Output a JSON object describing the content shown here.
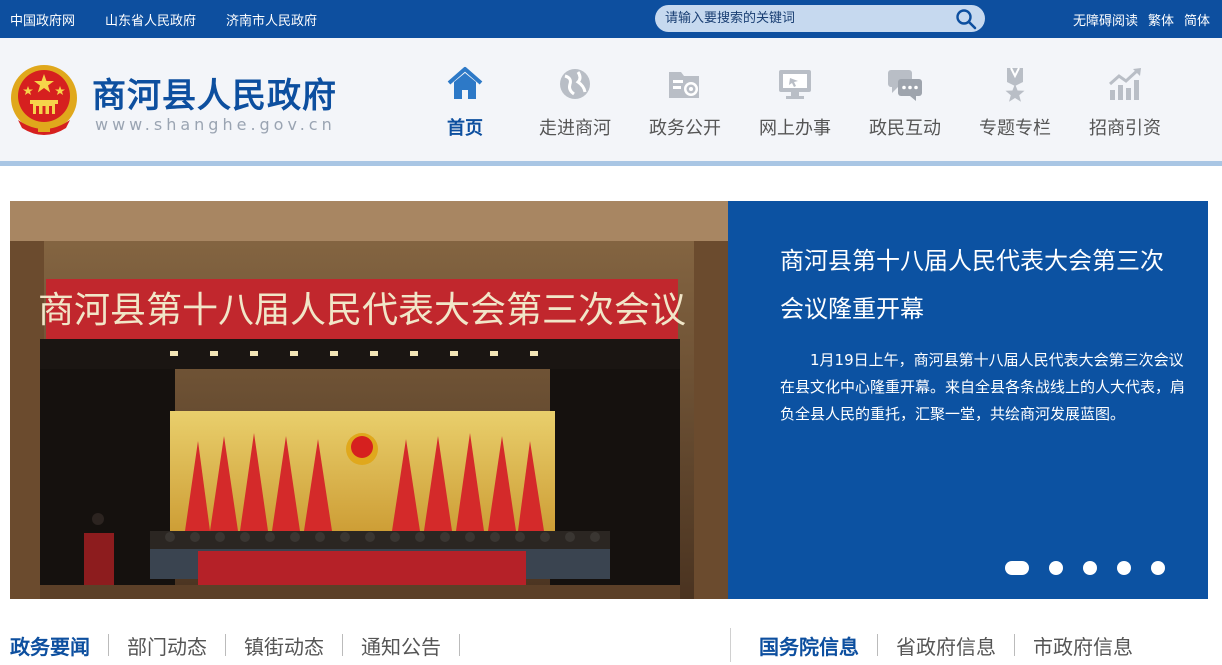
{
  "topbar": {
    "links": [
      "中国政府网",
      "山东省人民政府",
      "济南市人民政府"
    ],
    "search_placeholder": "请输入要搜索的关键词",
    "right_links": [
      "无障碍阅读",
      "繁体",
      "简体"
    ]
  },
  "header": {
    "site_name": "商河县人民政府",
    "site_url": "www.shanghe.gov.cn"
  },
  "nav": {
    "items": [
      {
        "label": "首页",
        "icon": "home-icon"
      },
      {
        "label": "走进商河",
        "icon": "globe-icon"
      },
      {
        "label": "政务公开",
        "icon": "folder-gear-icon"
      },
      {
        "label": "网上办事",
        "icon": "monitor-icon"
      },
      {
        "label": "政民互动",
        "icon": "chat-icon"
      },
      {
        "label": "专题专栏",
        "icon": "badge-icon"
      },
      {
        "label": "招商引资",
        "icon": "chart-icon"
      }
    ],
    "active_index": 0
  },
  "banner": {
    "stage_banner_text": "商河县第十八届人民代表大会第三次会议",
    "title": "商河县第十八届人民代表大会第三次会议隆重开幕",
    "summary": "1月19日上午，商河县第十八届人民代表大会第三次会议在县文化中心隆重开幕。来自全县各条战线上的人大代表，肩负全县人民的重托，汇聚一堂，共绘商河发展蓝图。",
    "slide_count": 5,
    "active_slide": 0
  },
  "news_tabs": {
    "left": [
      "政务要闻",
      "部门动态",
      "镇街动态",
      "通知公告"
    ],
    "right": [
      "国务院信息",
      "省政府信息",
      "市政府信息"
    ]
  },
  "colors": {
    "primary": "#0d4f9f",
    "banner_panel": "#0c52a2",
    "header_bg": "#f3f5f9",
    "search_bg": "#c6d9ef"
  }
}
